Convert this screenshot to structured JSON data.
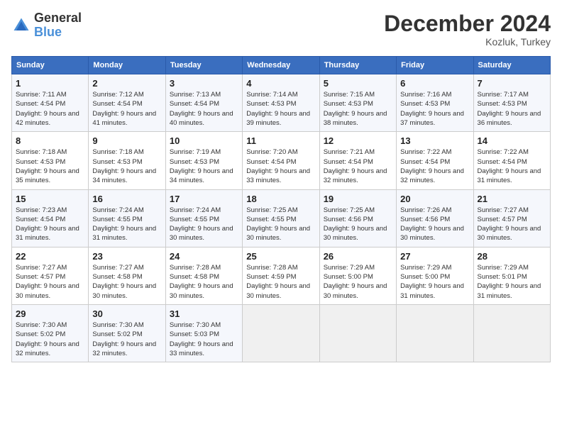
{
  "header": {
    "logo_line1": "General",
    "logo_line2": "Blue",
    "month_title": "December 2024",
    "location": "Kozluk, Turkey"
  },
  "calendar": {
    "days_of_week": [
      "Sunday",
      "Monday",
      "Tuesday",
      "Wednesday",
      "Thursday",
      "Friday",
      "Saturday"
    ],
    "weeks": [
      [
        {
          "day": "",
          "empty": true
        },
        {
          "day": "",
          "empty": true
        },
        {
          "day": "",
          "empty": true
        },
        {
          "day": "",
          "empty": true
        },
        {
          "day": "",
          "empty": true
        },
        {
          "day": "",
          "empty": true
        },
        {
          "day": "",
          "empty": true
        }
      ],
      [
        {
          "day": "1",
          "sunrise": "7:11 AM",
          "sunset": "4:54 PM",
          "daylight": "9 hours and 42 minutes."
        },
        {
          "day": "2",
          "sunrise": "7:12 AM",
          "sunset": "4:54 PM",
          "daylight": "9 hours and 41 minutes."
        },
        {
          "day": "3",
          "sunrise": "7:13 AM",
          "sunset": "4:54 PM",
          "daylight": "9 hours and 40 minutes."
        },
        {
          "day": "4",
          "sunrise": "7:14 AM",
          "sunset": "4:53 PM",
          "daylight": "9 hours and 39 minutes."
        },
        {
          "day": "5",
          "sunrise": "7:15 AM",
          "sunset": "4:53 PM",
          "daylight": "9 hours and 38 minutes."
        },
        {
          "day": "6",
          "sunrise": "7:16 AM",
          "sunset": "4:53 PM",
          "daylight": "9 hours and 37 minutes."
        },
        {
          "day": "7",
          "sunrise": "7:17 AM",
          "sunset": "4:53 PM",
          "daylight": "9 hours and 36 minutes."
        }
      ],
      [
        {
          "day": "8",
          "sunrise": "7:18 AM",
          "sunset": "4:53 PM",
          "daylight": "9 hours and 35 minutes."
        },
        {
          "day": "9",
          "sunrise": "7:18 AM",
          "sunset": "4:53 PM",
          "daylight": "9 hours and 34 minutes."
        },
        {
          "day": "10",
          "sunrise": "7:19 AM",
          "sunset": "4:53 PM",
          "daylight": "9 hours and 34 minutes."
        },
        {
          "day": "11",
          "sunrise": "7:20 AM",
          "sunset": "4:54 PM",
          "daylight": "9 hours and 33 minutes."
        },
        {
          "day": "12",
          "sunrise": "7:21 AM",
          "sunset": "4:54 PM",
          "daylight": "9 hours and 32 minutes."
        },
        {
          "day": "13",
          "sunrise": "7:22 AM",
          "sunset": "4:54 PM",
          "daylight": "9 hours and 32 minutes."
        },
        {
          "day": "14",
          "sunrise": "7:22 AM",
          "sunset": "4:54 PM",
          "daylight": "9 hours and 31 minutes."
        }
      ],
      [
        {
          "day": "15",
          "sunrise": "7:23 AM",
          "sunset": "4:54 PM",
          "daylight": "9 hours and 31 minutes."
        },
        {
          "day": "16",
          "sunrise": "7:24 AM",
          "sunset": "4:55 PM",
          "daylight": "9 hours and 31 minutes."
        },
        {
          "day": "17",
          "sunrise": "7:24 AM",
          "sunset": "4:55 PM",
          "daylight": "9 hours and 30 minutes."
        },
        {
          "day": "18",
          "sunrise": "7:25 AM",
          "sunset": "4:55 PM",
          "daylight": "9 hours and 30 minutes."
        },
        {
          "day": "19",
          "sunrise": "7:25 AM",
          "sunset": "4:56 PM",
          "daylight": "9 hours and 30 minutes."
        },
        {
          "day": "20",
          "sunrise": "7:26 AM",
          "sunset": "4:56 PM",
          "daylight": "9 hours and 30 minutes."
        },
        {
          "day": "21",
          "sunrise": "7:27 AM",
          "sunset": "4:57 PM",
          "daylight": "9 hours and 30 minutes."
        }
      ],
      [
        {
          "day": "22",
          "sunrise": "7:27 AM",
          "sunset": "4:57 PM",
          "daylight": "9 hours and 30 minutes."
        },
        {
          "day": "23",
          "sunrise": "7:27 AM",
          "sunset": "4:58 PM",
          "daylight": "9 hours and 30 minutes."
        },
        {
          "day": "24",
          "sunrise": "7:28 AM",
          "sunset": "4:58 PM",
          "daylight": "9 hours and 30 minutes."
        },
        {
          "day": "25",
          "sunrise": "7:28 AM",
          "sunset": "4:59 PM",
          "daylight": "9 hours and 30 minutes."
        },
        {
          "day": "26",
          "sunrise": "7:29 AM",
          "sunset": "5:00 PM",
          "daylight": "9 hours and 30 minutes."
        },
        {
          "day": "27",
          "sunrise": "7:29 AM",
          "sunset": "5:00 PM",
          "daylight": "9 hours and 31 minutes."
        },
        {
          "day": "28",
          "sunrise": "7:29 AM",
          "sunset": "5:01 PM",
          "daylight": "9 hours and 31 minutes."
        }
      ],
      [
        {
          "day": "29",
          "sunrise": "7:30 AM",
          "sunset": "5:02 PM",
          "daylight": "9 hours and 32 minutes."
        },
        {
          "day": "30",
          "sunrise": "7:30 AM",
          "sunset": "5:02 PM",
          "daylight": "9 hours and 32 minutes."
        },
        {
          "day": "31",
          "sunrise": "7:30 AM",
          "sunset": "5:03 PM",
          "daylight": "9 hours and 33 minutes."
        },
        {
          "day": "",
          "empty": true
        },
        {
          "day": "",
          "empty": true
        },
        {
          "day": "",
          "empty": true
        },
        {
          "day": "",
          "empty": true
        }
      ]
    ]
  }
}
